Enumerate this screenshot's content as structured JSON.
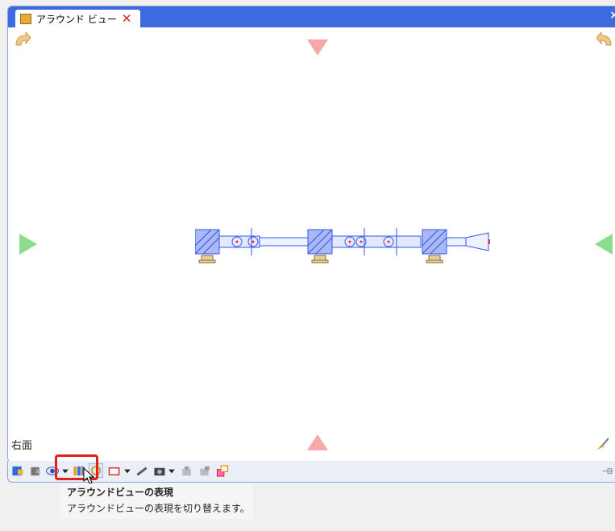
{
  "window": {
    "tab_title": "アラウンド ビュー",
    "tab_close_glyph": "✕",
    "close_glyph": "×"
  },
  "view": {
    "name": "右面"
  },
  "toolbar": {
    "items": [
      "view-origin-icon",
      "view-back-icon",
      "display-mode-icon",
      "dropdown-arrow",
      "grid-icon",
      "rotate-icon",
      "frame-icon",
      "dropdown-arrow",
      "pen-icon",
      "camera-icon",
      "dropdown-arrow",
      "copy-icon",
      "paste-icon",
      "export-icon",
      "pin-icon"
    ]
  },
  "tooltip": {
    "title": "アラウンドビューの表現",
    "description": "アラウンドビューの表現を切り替えます。"
  },
  "colors": {
    "titlebar": "#3e6ae1",
    "arrow_pink": "#f7a8a8",
    "arrow_green": "#8ddc8d",
    "drawing_blue": "#3355ee",
    "highlight_red": "#e0201a"
  }
}
